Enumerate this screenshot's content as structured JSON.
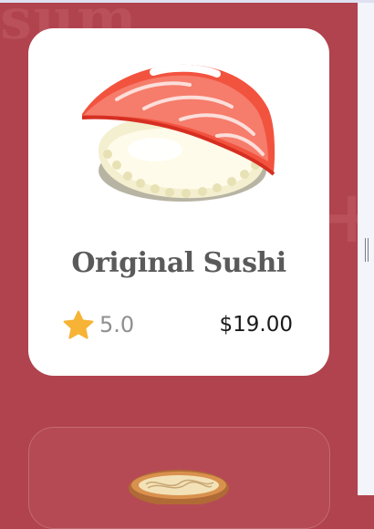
{
  "background_text": "sum",
  "background_plus": "+",
  "product": {
    "title": "Original Sushi",
    "rating": "5.0",
    "price": "$19.00",
    "image_icon": "salmon-nigiri-icon"
  },
  "next_product": {
    "image_icon": "noodle-bowl-icon"
  },
  "colors": {
    "background": "#b0434d",
    "card": "#ffffff",
    "star": "#f7b335",
    "title": "#5a5a5a",
    "price": "#1a1a1a"
  }
}
